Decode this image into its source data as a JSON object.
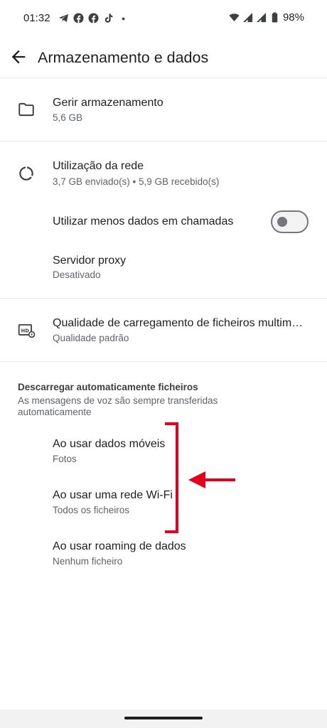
{
  "status_bar": {
    "time": "01:32",
    "notification_icons": [
      "telegram-icon",
      "facebook-icon",
      "facebook-icon",
      "tiktok-icon",
      "dot-icon"
    ],
    "battery": "98%"
  },
  "header": {
    "title": "Armazenamento e dados"
  },
  "storage": {
    "manage_title": "Gerir armazenamento",
    "manage_sub": "5,6 GB"
  },
  "network": {
    "usage_title": "Utilização da rede",
    "usage_sub": "3,7 GB enviado(s) • 5,9 GB recebido(s)",
    "less_data_title": "Utilizar menos dados em chamadas",
    "less_data_enabled": false,
    "proxy_title": "Servidor proxy",
    "proxy_sub": "Desativado"
  },
  "media": {
    "quality_title": "Qualidade de carregamento de ficheiros multimédia",
    "quality_sub": "Qualidade padrão"
  },
  "auto_download": {
    "header": "Descarregar automaticamente ficheiros",
    "description": "As mensagens de voz são sempre transferidas automaticamente",
    "items": [
      {
        "title": "Ao usar dados móveis",
        "sub": "Fotos"
      },
      {
        "title": "Ao usar uma rede Wi-Fi",
        "sub": "Todos os ficheiros"
      },
      {
        "title": "Ao usar roaming de dados",
        "sub": "Nenhum ficheiro"
      }
    ]
  },
  "colors": {
    "annotation": "#e2001a",
    "text_primary": "#1f1f1f",
    "text_secondary": "#5f6368"
  }
}
